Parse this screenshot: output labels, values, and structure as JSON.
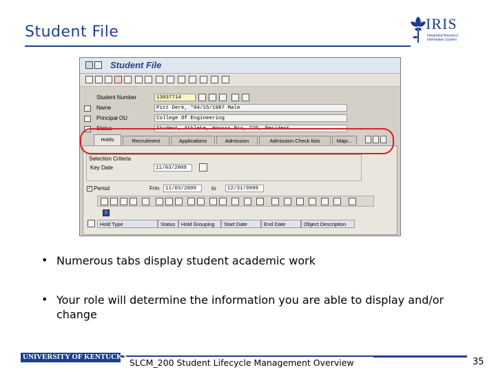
{
  "slide": {
    "title": "Student File",
    "logo_word": "IRIS",
    "logo_sub": "Integrated Resource Information System",
    "bullets": [
      "Numerous tabs display student academic work",
      "Your role will determine the information you are able to display and/or change"
    ],
    "footer_org": "UNIVERSITY OF KENTUCKY",
    "footer_text": "SLCM_200 Student Lifecycle Management Overview",
    "page_number": "35",
    "colors": {
      "title": "#1f3f8f",
      "highlight_oval": "#d81e28"
    }
  },
  "sap": {
    "header_title": "Student File",
    "fields": {
      "student_number": {
        "label": "Student Number",
        "value": "13037714"
      },
      "name": {
        "label": "Name",
        "value": "Pitt Derk, *04/15/1987 Male"
      },
      "principal_ou": {
        "label": "Principal OU",
        "value": "College Of Engineering"
      },
      "status": {
        "label": "Status",
        "value": "Student, Athlete, Honors Pro, CUS, Resident"
      }
    },
    "tabs": [
      "Holds",
      "Recruitment",
      "Applications",
      "Admission",
      "Admission Check lists",
      "Majo..."
    ],
    "selection": {
      "title": "Selection Criteria",
      "key_date_label": "Key Date",
      "key_date_value": "11/03/2009",
      "period_label": "Period",
      "from_label": "Frm",
      "from_value": "11/03/2009",
      "to_label": "to",
      "to_value": "12/31/9999"
    },
    "grid_columns": [
      "Hold Type",
      "Status",
      "Hold Grouping",
      "Start Date",
      "End Date",
      "Object Description"
    ]
  }
}
